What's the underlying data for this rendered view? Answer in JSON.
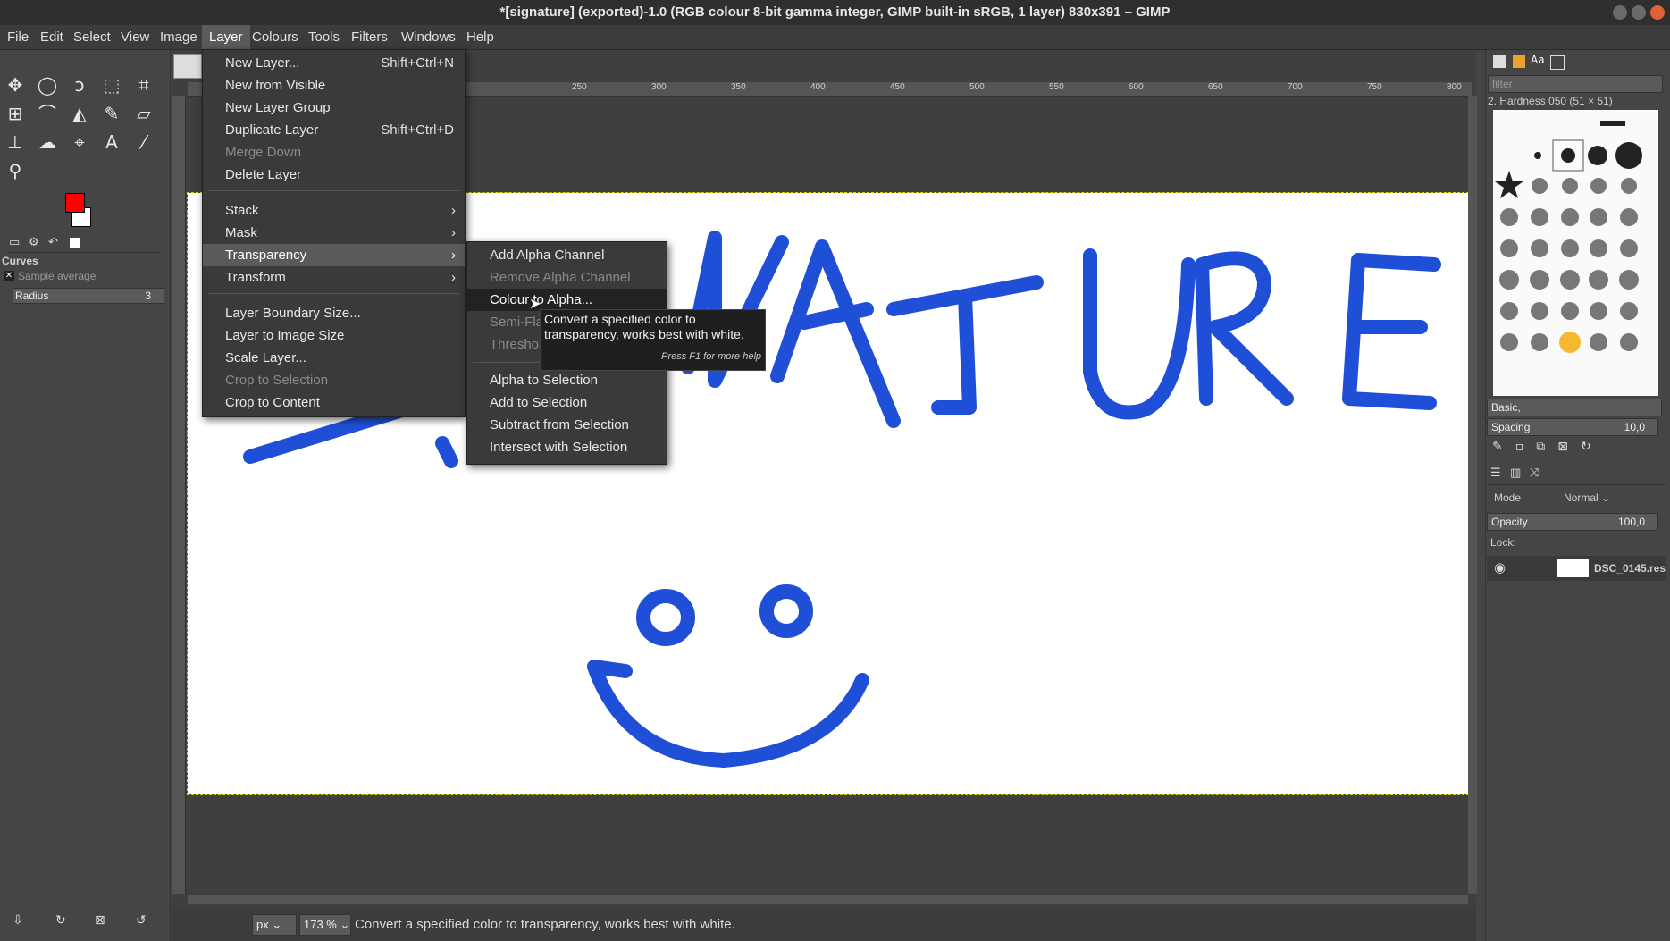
{
  "window": {
    "title": "*[signature] (exported)-1.0 (RGB colour 8-bit gamma integer, GIMP built-in sRGB, 1 layer) 830x391 – GIMP"
  },
  "menubar": [
    "File",
    "Edit",
    "Select",
    "View",
    "Image",
    "Layer",
    "Colours",
    "Tools",
    "Filters",
    "Windows",
    "Help"
  ],
  "layer_menu": {
    "items": [
      {
        "label": "New Layer...",
        "shortcut": "Shift+Ctrl+N"
      },
      {
        "label": "New from Visible",
        "shortcut": ""
      },
      {
        "label": "New Layer Group",
        "shortcut": ""
      },
      {
        "label": "Duplicate Layer",
        "shortcut": "Shift+Ctrl+D"
      },
      {
        "label": "Merge Down",
        "shortcut": ""
      },
      {
        "label": "Delete Layer",
        "shortcut": ""
      },
      {
        "label": "Stack"
      },
      {
        "label": "Mask"
      },
      {
        "label": "Transparency"
      },
      {
        "label": "Transform"
      },
      {
        "label": "Layer Boundary Size..."
      },
      {
        "label": "Layer to Image Size"
      },
      {
        "label": "Scale Layer..."
      },
      {
        "label": "Crop to Selection"
      },
      {
        "label": "Crop to Content"
      }
    ]
  },
  "transparency_menu": {
    "items": [
      "Add Alpha Channel",
      "Remove Alpha Channel",
      "Colour to Alpha...",
      "Semi-Fla",
      "Thresho",
      "Alpha to Selection",
      "Add to Selection",
      "Subtract from Selection",
      "Intersect with Selection"
    ]
  },
  "tooltip": {
    "line1": "Convert a specified color to",
    "line2": "transparency, works best with white.",
    "help": "Press F1 for more help"
  },
  "tool_options": {
    "title": "Curves",
    "sample_average": "Sample average",
    "radius_label": "Radius",
    "radius_value": "3"
  },
  "ruler_labels": [
    "250",
    "300",
    "350",
    "400",
    "450",
    "500",
    "550",
    "600",
    "650",
    "700",
    "750",
    "800"
  ],
  "canvas_text": "NATURE",
  "brushes": {
    "filter_placeholder": "filter",
    "current": "2. Hardness 050 (51 × 51)",
    "preset": "Basic,",
    "spacing_label": "Spacing",
    "spacing_value": "10,0"
  },
  "layers": {
    "mode_label": "Mode",
    "mode_value": "Normal",
    "opacity_label": "Opacity",
    "opacity_value": "100,0",
    "lock_label": "Lock:",
    "layer_name": "DSC_0145.res"
  },
  "statusbar": {
    "unit": "px",
    "zoom": "173 %",
    "message": "Convert a specified color to transparency, works best with white."
  },
  "colors": {
    "foreground": "#ff0000",
    "background": "#ffffff",
    "ink": "#1f4fd6"
  }
}
